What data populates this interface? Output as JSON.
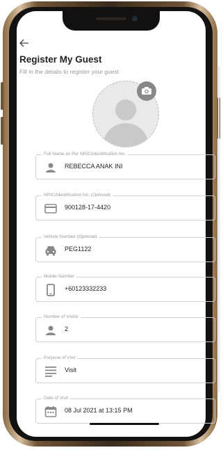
{
  "header": {
    "back_icon": "arrow-left-icon",
    "title": "Register My Guest",
    "subtitle": "Fill in the details to register your guest"
  },
  "photo": {
    "avatar_icon": "person-placeholder-icon",
    "camera_icon": "camera-icon"
  },
  "fields": [
    {
      "label": "Full Name as Per NRIC/Identification No.",
      "value": "REBECCA ANAK INI",
      "icon": "person-icon"
    },
    {
      "label": "NRIC/Identification No. (Optional)",
      "value": "900128-17-4420",
      "icon": "id-card-icon"
    },
    {
      "label": "Vehicle Number (Optional)",
      "value": "PEG1122",
      "icon": "car-icon"
    },
    {
      "label": "Mobile Number",
      "value": "+60123332233",
      "icon": "phone-icon"
    },
    {
      "label": "Number of Visitor",
      "value": "2",
      "icon": "person-icon"
    },
    {
      "label": "Purpose of Visit",
      "value": "Visit",
      "icon": "notes-icon"
    },
    {
      "label": "Date of Visit",
      "value": "08 Jul 2021 at 13:15 PM",
      "icon": "calendar-icon"
    }
  ],
  "colors": {
    "frame_gold": "#8a6a43",
    "border": "#cfcfcf",
    "icon_gray": "#888888",
    "text": "#222222"
  }
}
